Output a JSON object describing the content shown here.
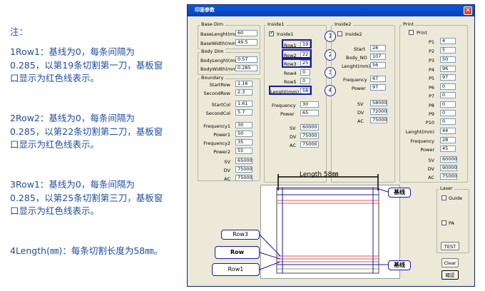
{
  "note": {
    "title": "注：",
    "p1": "1Row1：基线为0，每条间隔为0.285，以第19条切割第一刀，基板窗口显示为红色线表示。",
    "p2": "2Row2：基线为0，每条间隔为0.285，以第22条切割第二刀，基板窗口显示为红色线表示。",
    "p3": "3Row1：基线为0，每条间隔为0.285，以第25条切割第三刀，基板窗口显示为红色线表示。",
    "p4": "4Length(㎜)：每条切割长度为58㎜。"
  },
  "dialog": {
    "title": "印面参数",
    "close": "✕",
    "base_dim": {
      "label": "Base Dim",
      "length_label": "BaseLenght(mm)",
      "length": "60",
      "width_label": "BaseWidth(mm)",
      "width": "49.5"
    },
    "body_dim": {
      "label": "Body Dim",
      "length_label": "BodyLenght(mm)",
      "length": "0.57",
      "width_label": "BodyWidth(mm)",
      "width": "0.285"
    },
    "boundary": {
      "label": "Boundary",
      "rows": [
        {
          "label": "StartRow",
          "value": "1.16"
        },
        {
          "label": "SecondRow",
          "value": "2.3"
        },
        {
          "label": "StartCol",
          "value": "1.61"
        },
        {
          "label": "SecondCol",
          "value": "5.7"
        },
        {
          "label": "Frequency1",
          "value": "30"
        },
        {
          "label": "Power1",
          "value": "50"
        },
        {
          "label": "Frequency2",
          "value": "35"
        },
        {
          "label": "Power2",
          "value": "55"
        },
        {
          "label": "SV",
          "value": "65000"
        },
        {
          "label": "DV",
          "value": "75000"
        },
        {
          "label": "AC",
          "value": "75000"
        }
      ]
    },
    "inside1": {
      "label": "Inside1",
      "check_label": "Inside1",
      "rows": [
        {
          "label": "Row1",
          "value": "19"
        },
        {
          "label": "Row2",
          "value": "22"
        },
        {
          "label": "Row3",
          "value": "25"
        },
        {
          "label": "Row4",
          "value": "0"
        },
        {
          "label": "Row5",
          "value": "0"
        }
      ],
      "length_label": "Lenght(mm)",
      "length": "58",
      "freq_label": "Frequency",
      "freq": "30",
      "power_label": "Power",
      "power": "65",
      "sv_label": "SV",
      "sv": "60000",
      "dv_label": "DV",
      "dv": "75000",
      "ac_label": "AC",
      "ac": "75000"
    },
    "inside2": {
      "label": "Inside2",
      "check_label": "Inside2",
      "start_label": "Start",
      "start": "28",
      "bodyno_label": "Body_NO",
      "bodyno": "107",
      "length_label": "Lenght(mm)",
      "length": "56",
      "freq_label": "Frequency",
      "freq": "67",
      "power_label": "Power",
      "power": "97",
      "sv_label": "SV",
      "sv": "58000",
      "dv_label": "DV",
      "dv": "72000",
      "ac_label": "AC",
      "ac": "75000"
    },
    "print": {
      "label": "Print",
      "check_label": "Print",
      "rows": [
        {
          "label": "P1",
          "value": "4"
        },
        {
          "label": "P2",
          "value": "5"
        },
        {
          "label": "P3",
          "value": "50"
        },
        {
          "label": "P4",
          "value": "96"
        },
        {
          "label": "P5",
          "value": "97"
        },
        {
          "label": "P6",
          "value": "0"
        },
        {
          "label": "P7",
          "value": "0"
        },
        {
          "label": "P8",
          "value": "0"
        },
        {
          "label": "P9",
          "value": "0"
        },
        {
          "label": "P10",
          "value": "0"
        },
        {
          "label": "Lenght(mm)",
          "value": "44"
        },
        {
          "label": "Frequency",
          "value": "28"
        },
        {
          "label": "Power",
          "value": "45"
        },
        {
          "label": "SV",
          "value": "60000"
        },
        {
          "label": "DV",
          "value": "90000"
        },
        {
          "label": "AC",
          "value": "75000"
        }
      ]
    },
    "laser": {
      "label": "Laser",
      "guide": "Guide",
      "pa": "PA",
      "test": "TEST"
    },
    "clear_btn": "Clear",
    "confirm_btn": "確認",
    "markers": [
      "1",
      "2",
      "3",
      "4"
    ],
    "length_annotation": "Length 58㎜",
    "baseline_label": "基线",
    "callouts": {
      "row3": "Row3",
      "row": "Row",
      "row1": "Row1"
    }
  }
}
